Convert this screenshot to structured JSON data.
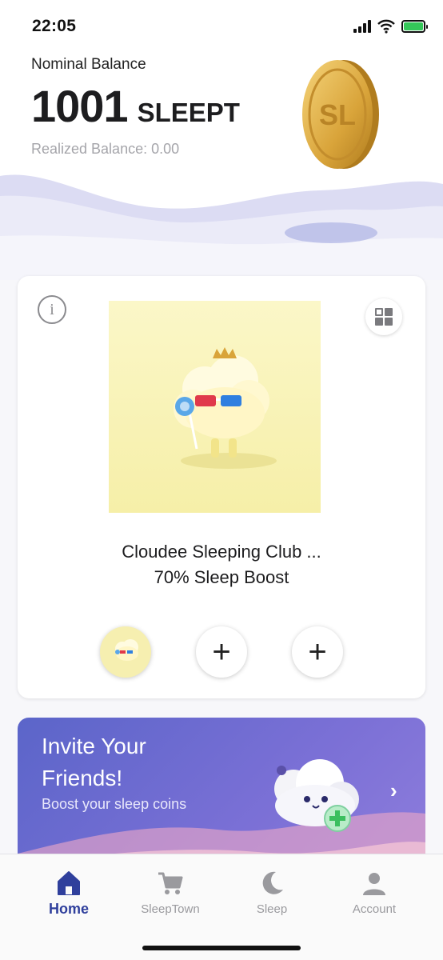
{
  "status": {
    "time": "22:05"
  },
  "header": {
    "nominal_label": "Nominal Balance",
    "balance_value": "1001",
    "balance_unit": "SLEEPT",
    "realized_label": "Realized Balance: 0.00"
  },
  "nft": {
    "name": "Cloudee Sleeping Club ...",
    "boost": "70% Sleep Boost",
    "slot_2": "+",
    "slot_3": "+"
  },
  "invite": {
    "title": "Invite Your Friends!",
    "subtitle": "Boost your sleep coins",
    "chevron": "›"
  },
  "tabs": [
    {
      "label": "Home",
      "icon": "home-icon",
      "active": true
    },
    {
      "label": "SleepTown",
      "icon": "cart-icon",
      "active": false
    },
    {
      "label": "Sleep",
      "icon": "moon-icon",
      "active": false
    },
    {
      "label": "Account",
      "icon": "user-icon",
      "active": false
    }
  ],
  "colors": {
    "accent": "#2f3f9c",
    "invite_bg": "#6a6ad0",
    "coin": "#d9a43a",
    "nft_bg": "#f8f2b8"
  }
}
